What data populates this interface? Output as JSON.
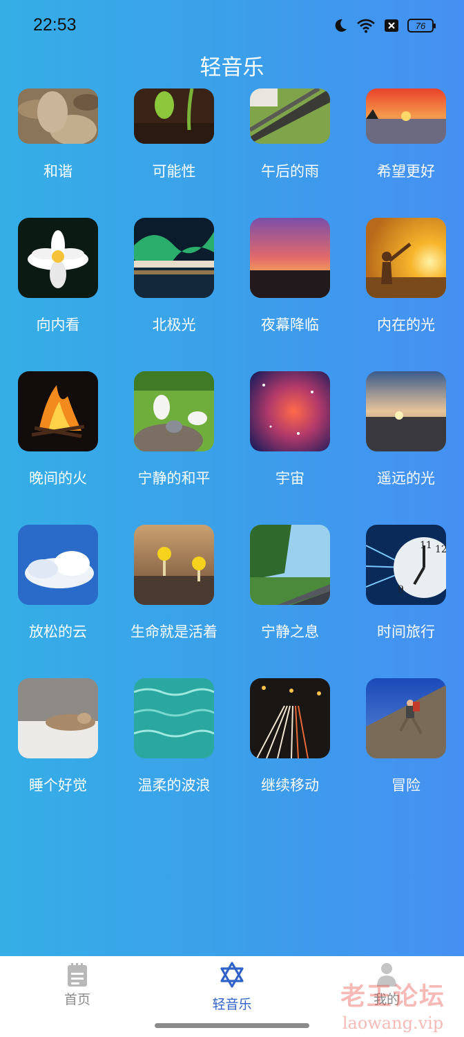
{
  "status_bar": {
    "time": "22:53",
    "battery": "76",
    "icons": [
      "moon-icon",
      "wifi-icon",
      "notification-x-icon",
      "battery-icon"
    ]
  },
  "header": {
    "title": "轻音乐"
  },
  "tracks": [
    {
      "label": "和谐",
      "image": "stones"
    },
    {
      "label": "可能性",
      "image": "sprout"
    },
    {
      "label": "午后的雨",
      "image": "roof-rain"
    },
    {
      "label": "希望更好",
      "image": "sea-sunset"
    },
    {
      "label": "向内看",
      "image": "water-lily"
    },
    {
      "label": "北极光",
      "image": "aurora"
    },
    {
      "label": "夜幕降临",
      "image": "dusk"
    },
    {
      "label": "内在的光",
      "image": "woman-sunrise"
    },
    {
      "label": "晚间的火",
      "image": "campfire"
    },
    {
      "label": "宁静的和平",
      "image": "doves"
    },
    {
      "label": "宇宙",
      "image": "nebula"
    },
    {
      "label": "遥远的光",
      "image": "horizon-sunset"
    },
    {
      "label": "放松的云",
      "image": "clouds"
    },
    {
      "label": "生命就是活着",
      "image": "mushrooms"
    },
    {
      "label": "宁静之息",
      "image": "road-trees"
    },
    {
      "label": "时间旅行",
      "image": "clock"
    },
    {
      "label": "睡个好觉",
      "image": "sleeping-cat"
    },
    {
      "label": "温柔的波浪",
      "image": "water-ripples"
    },
    {
      "label": "继续移动",
      "image": "light-trails"
    },
    {
      "label": "冒险",
      "image": "climber"
    }
  ],
  "tabbar": {
    "tabs": [
      {
        "label": "首页",
        "icon": "document-icon",
        "active": false
      },
      {
        "label": "轻音乐",
        "icon": "star-of-david-icon",
        "active": true
      },
      {
        "label": "我的",
        "icon": "person-icon",
        "active": false
      }
    ],
    "active_color": "#2f63c9",
    "inactive_color": "#9a9a9a"
  },
  "watermark": {
    "title": "老王论坛",
    "url": "laowang.vip"
  }
}
